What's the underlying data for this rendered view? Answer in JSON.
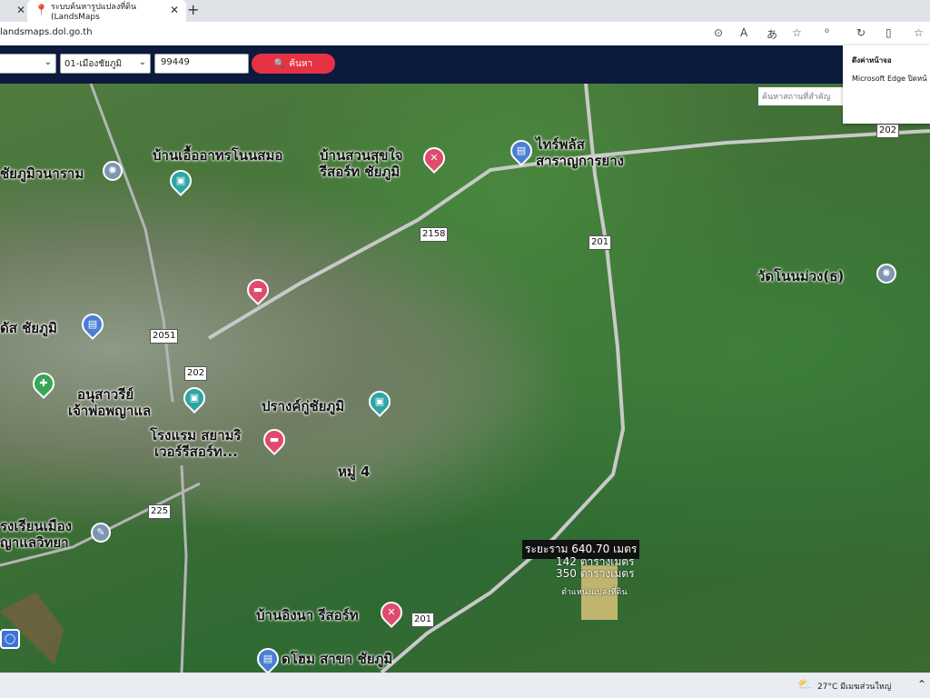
{
  "browser": {
    "tabs": [
      {
        "label": ""
      },
      {
        "label": "ระบบค้นหารูปแปลงที่ดิน (LandsMaps"
      }
    ],
    "url": "landsmaps.dol.go.th"
  },
  "app": {
    "district_select": "01-เมืองชัยภูมิ",
    "parcel_input": "99449",
    "search_label": "ค้นหา",
    "map_search_placeholder": "ค้นหาสถานที่สำคัญ"
  },
  "popup": {
    "title": "ดึงค่าหน้าจอ",
    "text": "Microsoft Edge ปิดหน้"
  },
  "map": {
    "places": [
      "บ้านเอื้ออาทรโนนสมอ",
      "บ้านสวนสุขใจ",
      "รีสอร์ท ชัยภูมิ",
      "ไทร์พลัส",
      "สาราญการยาง",
      "ชัยภูมิวนาราม",
      "วัดโนนม่วง(ธ)",
      "ดัส ชัยภูมิ",
      "อนุสาวรีย์",
      "เจ้าพ่อพญาแล",
      "ปรางค์กู่ชัยภูมิ",
      "โรงแรม สยามริ",
      "เวอร์รีสอร์ท...",
      "หมู่ 4",
      "รงเรียนเมือง",
      "ญาแลวิทยา",
      "บ้านอิงนา รีสอร์ท",
      "ดโฮม สาขา ชัยภูมิ"
    ],
    "roads": [
      "202",
      "2158",
      "201",
      "2051",
      "202",
      "225",
      "201"
    ],
    "measure_label": "ระยะราม 640.70 เมตร",
    "area_label_1": "142 ตารางเมตร",
    "area_label_2": "350 ตารางเมตร",
    "parcel_caption": "ตำแหน่งแปลงที่ดิน"
  },
  "taskbar": {
    "weather": "27°C  มีเมฆส่วนใหญ่"
  }
}
